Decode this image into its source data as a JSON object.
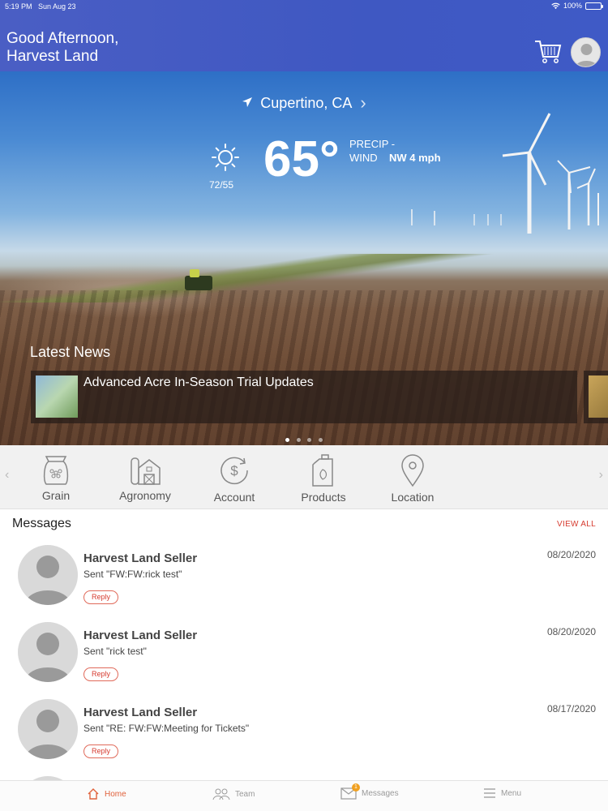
{
  "status_bar": {
    "time": "5:19 PM",
    "date": "Sun Aug 23",
    "battery": "100%"
  },
  "header": {
    "greeting_line1": "Good Afternoon,",
    "greeting_line2": "Harvest Land"
  },
  "weather": {
    "location": "Cupertino, CA",
    "temp": "65°",
    "hilo": "72/55",
    "precip_label": "PRECIP -",
    "wind_label": "WIND",
    "wind_value": "NW 4 mph"
  },
  "news": {
    "title": "Latest News",
    "items": [
      {
        "headline": "Advanced Acre In-Season Trial Updates"
      }
    ],
    "page_index": 1,
    "page_count": 4
  },
  "quick_nav": [
    "Grain",
    "Agronomy",
    "Account",
    "Products",
    "Location"
  ],
  "messages": {
    "title": "Messages",
    "view_all": "VIEW ALL",
    "reply_label": "Reply",
    "items": [
      {
        "sender": "Harvest Land Seller",
        "snippet": "Sent \"FW:FW:rick test\"",
        "date": "08/20/2020"
      },
      {
        "sender": "Harvest Land Seller",
        "snippet": "Sent \"rick test\"",
        "date": "08/20/2020"
      },
      {
        "sender": "Harvest Land Seller",
        "snippet": "Sent \"RE: FW:FW:Meeting for Tickets\"",
        "date": "08/17/2020"
      }
    ]
  },
  "tabbar": {
    "home": "Home",
    "team": "Team",
    "messages": "Messages",
    "messages_badge": "1",
    "menu": "Menu",
    "active": "Home"
  },
  "colors": {
    "header": "#3f58c2",
    "accent": "#d63b2f",
    "active_tab": "#e0623c"
  }
}
